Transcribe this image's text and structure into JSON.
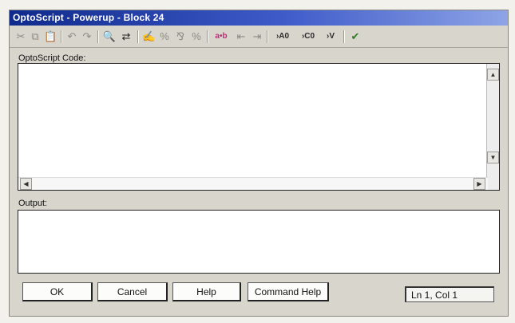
{
  "window": {
    "title": "OptoScript - Powerup - Block 24"
  },
  "toolbar": {
    "cut": "✂",
    "copy": "⧉",
    "paste": "📋",
    "undo": "↶",
    "redo": "↷",
    "find": "🔍",
    "replace": "⇄",
    "insert_1": "✍",
    "insert_2": "%",
    "insert_3": "⅋",
    "insert_4": "%",
    "ab": "a•b",
    "indent": "⇤",
    "outdent": "⇥",
    "ao": "›A0",
    "co": "›C0",
    "v": "›V",
    "compile": "✔"
  },
  "code_section": {
    "label": "OptoScript Code:",
    "value": ""
  },
  "output_section": {
    "label": "Output:",
    "value": ""
  },
  "buttons": {
    "ok": "OK",
    "cancel": "Cancel",
    "help": "Help",
    "command_help": "Command Help"
  },
  "status": {
    "text": "Ln 1, Col 1"
  },
  "colors": {
    "titlebar": "#0f2a8c",
    "window_bg": "#d8d5cd"
  }
}
